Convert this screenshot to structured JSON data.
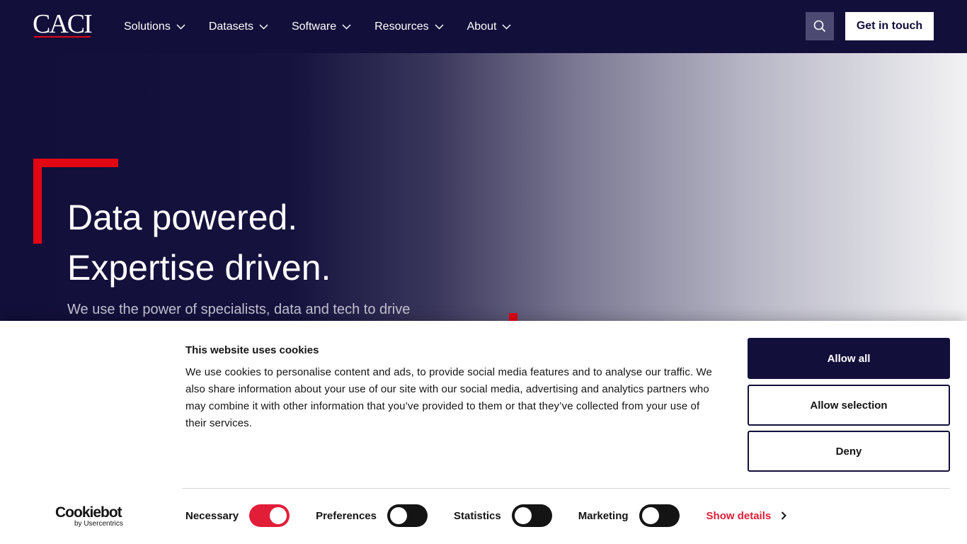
{
  "header": {
    "logo_text": "CACI",
    "nav": [
      {
        "label": "Solutions"
      },
      {
        "label": "Datasets"
      },
      {
        "label": "Software"
      },
      {
        "label": "Resources"
      },
      {
        "label": "About"
      }
    ],
    "search_icon": "search-icon",
    "cta_label": "Get in touch"
  },
  "hero": {
    "line1": "Data powered.",
    "line2": "Expertise driven.",
    "subtitle": "We use the power of specialists, data and tech to drive"
  },
  "cookie": {
    "title": "This website uses cookies",
    "text": "We use cookies to personalise content and ads, to provide social media features and to analyse our traffic. We also share information about your use of our site with our social media, advertising and analytics partners who may combine it with other information that you’ve provided to them or that they’ve collected from your use of their services.",
    "allow_all": "Allow all",
    "allow_selection": "Allow selection",
    "deny": "Deny",
    "brand_main": "Cookiebot",
    "brand_sub": "by Usercentrics",
    "toggles": [
      {
        "label": "Necessary",
        "on": true
      },
      {
        "label": "Preferences",
        "on": false
      },
      {
        "label": "Statistics",
        "on": false
      },
      {
        "label": "Marketing",
        "on": false
      }
    ],
    "show_details": "Show details"
  },
  "colors": {
    "navy": "#120f3a",
    "accent_red": "#e30613",
    "toggle_on": "#e21d38"
  }
}
